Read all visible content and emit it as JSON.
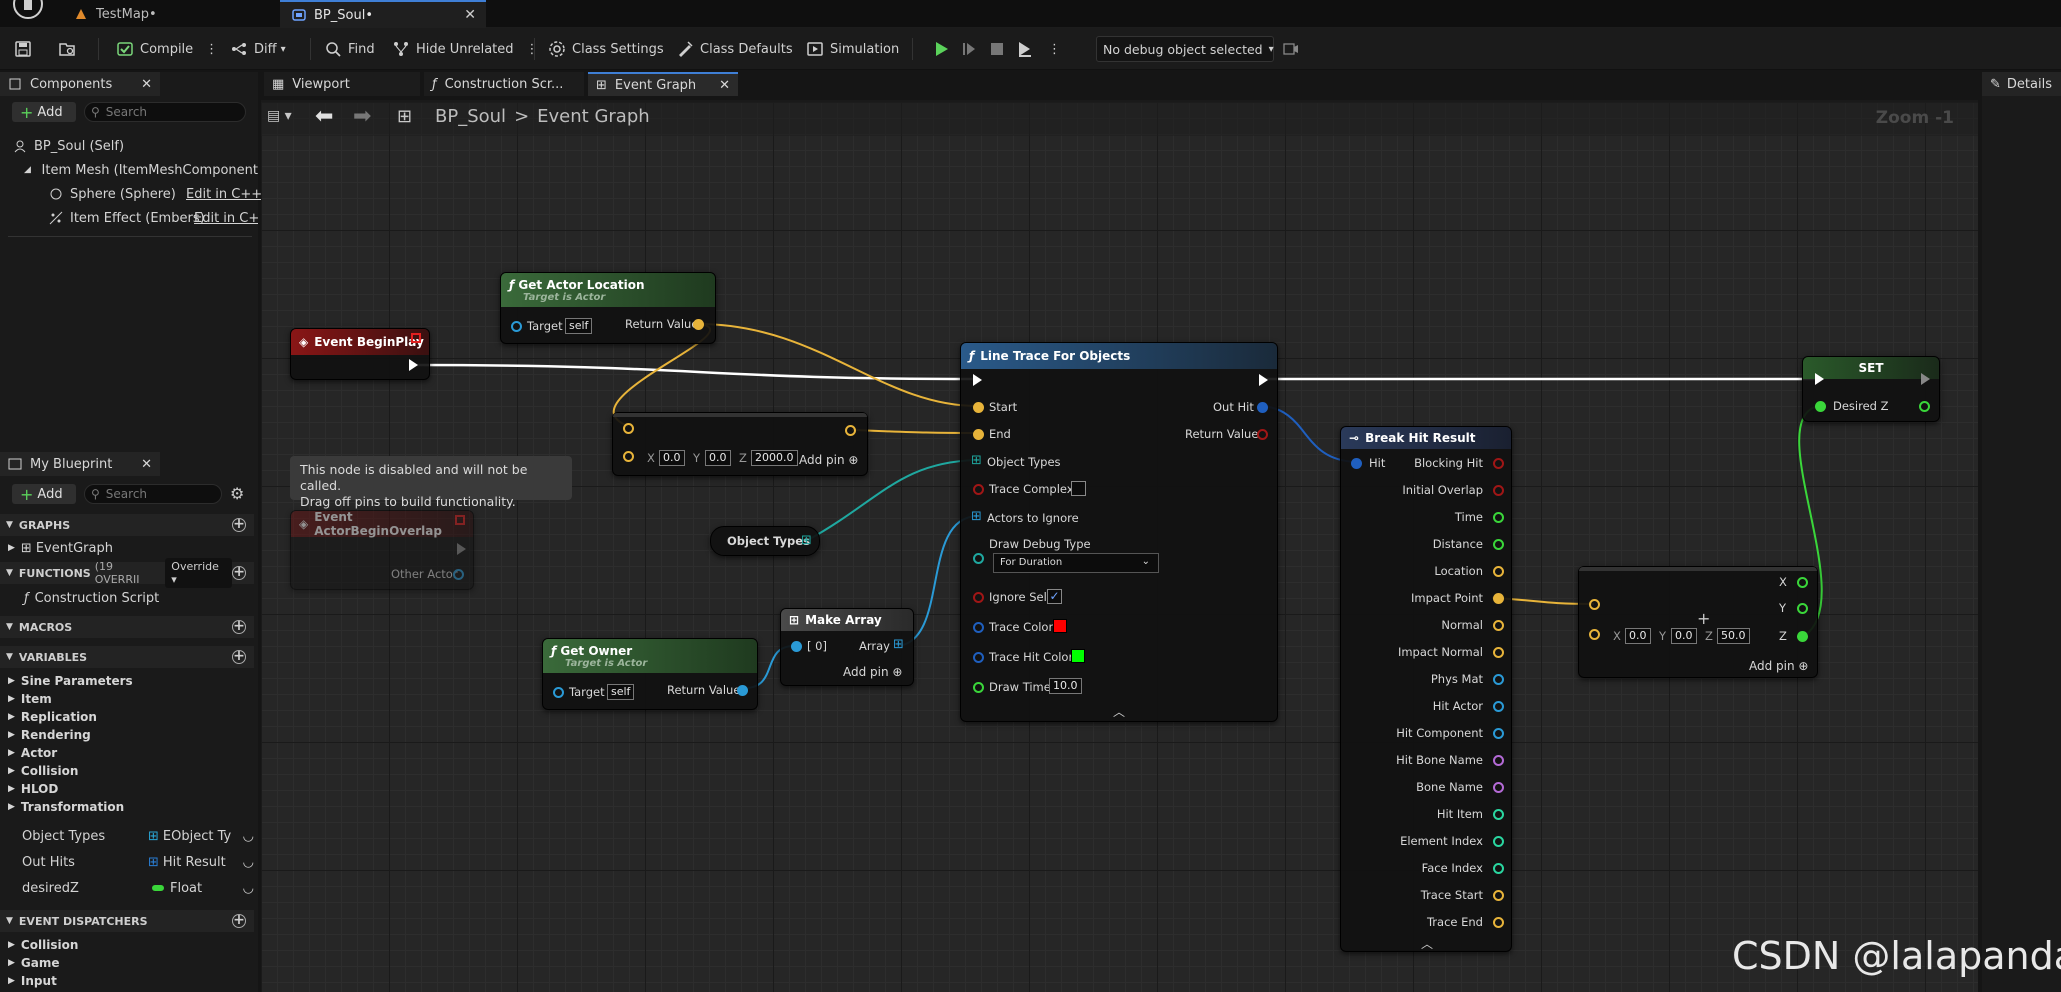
{
  "tabs": [
    {
      "label": "TestMap•",
      "active": false
    },
    {
      "label": "BP_Soul•",
      "active": true
    }
  ],
  "toolbar": {
    "compile": "Compile",
    "diff": "Diff",
    "find": "Find",
    "hide_unrelated": "Hide Unrelated",
    "class_settings": "Class Settings",
    "class_defaults": "Class Defaults",
    "simulation": "Simulation",
    "debug_object": "No debug object selected"
  },
  "components_panel": {
    "title": "Components",
    "add_label": "Add",
    "search_placeholder": "Search",
    "items": [
      {
        "label": "BP_Soul (Self)"
      },
      {
        "label": "Item Mesh (ItemMeshComponent"
      },
      {
        "label": "Sphere (Sphere)",
        "edit": "Edit in C++"
      },
      {
        "label": "Item Effect (Embers)",
        "edit": "Edit in C+"
      }
    ]
  },
  "editor_tabs": {
    "viewport": "Viewport",
    "construction": "Construction Scr...",
    "event_graph": "Event Graph",
    "details": "Details"
  },
  "breadcrumb": {
    "root": "BP_Soul",
    "separator": ">",
    "current": "Event Graph",
    "zoom": "Zoom -1"
  },
  "my_blueprint": {
    "title": "My Blueprint",
    "add_label": "Add",
    "search_placeholder": "Search",
    "graphs_label": "GRAPHS",
    "event_graph": "EventGraph",
    "functions_label": "FUNCTIONS",
    "functions_count": "(19 OVERRII",
    "override_label": "Override",
    "construction_script": "Construction Script",
    "macros_label": "MACROS",
    "variables_label": "VARIABLES",
    "variable_categories": [
      "Sine Parameters",
      "Item",
      "Replication",
      "Rendering",
      "Actor",
      "Collision",
      "HLOD",
      "Transformation"
    ],
    "variables": [
      {
        "name": "Object Types",
        "type": "EObject Ty",
        "color": "#2aa6d6"
      },
      {
        "name": "Out Hits",
        "type": "Hit Result",
        "color": "#2a7fd6"
      },
      {
        "name": "desiredZ",
        "type": "Float",
        "color": "#3ad63a"
      }
    ],
    "dispatchers_label": "EVENT DISPATCHERS",
    "dispatcher_categories": [
      "Collision",
      "Game",
      "Input"
    ]
  },
  "nodes": {
    "begin_play": {
      "title": "Event BeginPlay"
    },
    "get_actor_location": {
      "title": "Get Actor Location",
      "subtitle": "Target is Actor",
      "target": "Target",
      "self": "self",
      "return": "Return Value"
    },
    "add_vector": {
      "x": "0.0",
      "y": "0.0",
      "z": "2000.0",
      "add_pin": "Add pin"
    },
    "disabled_comment": "This node is disabled and will not be called.\nDrag off pins to build functionality.",
    "begin_overlap": {
      "title": "Event ActorBeginOverlap",
      "other_actor": "Other Actor"
    },
    "object_types": {
      "title": "Object Types"
    },
    "get_owner": {
      "title": "Get Owner",
      "subtitle": "Target is Actor",
      "target": "Target",
      "self": "self",
      "return": "Return Value"
    },
    "make_array": {
      "title": "Make Array",
      "index": "[ 0]",
      "array": "Array",
      "add_pin": "Add pin"
    },
    "line_trace": {
      "title": "Line Trace For Objects",
      "start": "Start",
      "end": "End",
      "object_types": "Object Types",
      "trace_complex": "Trace Complex",
      "actors_to_ignore": "Actors to Ignore",
      "draw_debug_type": "Draw Debug Type",
      "draw_debug_value": "For Duration",
      "ignore_self": "Ignore Self",
      "trace_color": "Trace Color",
      "trace_hit_color": "Trace Hit Color",
      "draw_time": "Draw Time",
      "draw_time_value": "10.0",
      "out_hit": "Out Hit",
      "return_value": "Return Value"
    },
    "break_hit": {
      "title": "Break Hit Result",
      "hit": "Hit",
      "outputs": [
        {
          "label": "Blocking Hit",
          "color": "#a01616"
        },
        {
          "label": "Initial Overlap",
          "color": "#a01616"
        },
        {
          "label": "Time",
          "color": "#3ad63a"
        },
        {
          "label": "Distance",
          "color": "#3ad63a"
        },
        {
          "label": "Location",
          "color": "#e8b43a"
        },
        {
          "label": "Impact Point",
          "color": "#e8b43a"
        },
        {
          "label": "Normal",
          "color": "#e8b43a"
        },
        {
          "label": "Impact Normal",
          "color": "#e8b43a"
        },
        {
          "label": "Phys Mat",
          "color": "#2a9ad6"
        },
        {
          "label": "Hit Actor",
          "color": "#2a9ad6"
        },
        {
          "label": "Hit Component",
          "color": "#2a9ad6"
        },
        {
          "label": "Hit Bone Name",
          "color": "#b46ad6"
        },
        {
          "label": "Bone Name",
          "color": "#b46ad6"
        },
        {
          "label": "Hit Item",
          "color": "#2ad6a0"
        },
        {
          "label": "Element Index",
          "color": "#2ad6a0"
        },
        {
          "label": "Face Index",
          "color": "#2ad6a0"
        },
        {
          "label": "Trace Start",
          "color": "#e8b43a"
        },
        {
          "label": "Trace End",
          "color": "#e8b43a"
        }
      ]
    },
    "add_vector2": {
      "x": "0.0",
      "y": "0.0",
      "z": "50.0",
      "add_pin": "Add pin",
      "out_x": "X",
      "out_y": "Y",
      "out_z": "Z"
    },
    "set": {
      "title": "SET",
      "desired_z": "Desired Z"
    }
  },
  "watermark": "CSDN @lalapanda",
  "colors": {
    "exec": "#ffffff",
    "vector": "#e8b43a",
    "object": "#2a9ad6",
    "float": "#3ad63a",
    "struct": "#1f5fbf",
    "accent": "#3f7fd6"
  }
}
